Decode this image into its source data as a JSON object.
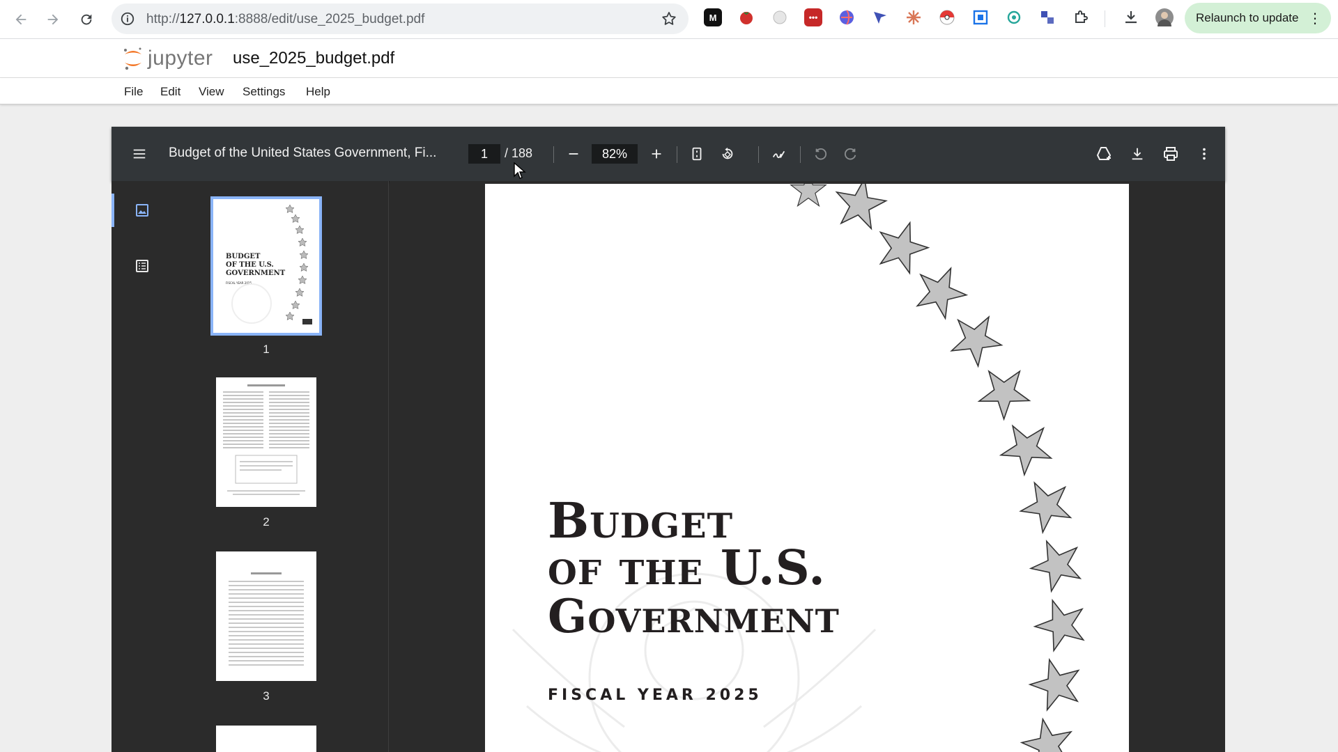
{
  "browser": {
    "url_prefix": "http://",
    "url_host": "127.0.0.1",
    "url_rest": ":8888/edit/use_2025_budget.pdf",
    "relaunch_label": "Relaunch to update",
    "extensions": [
      "M"
    ]
  },
  "jupyter": {
    "logo_text": "jupyter",
    "document_title": "use_2025_budget.pdf",
    "menu": [
      "File",
      "Edit",
      "View",
      "Settings",
      "Help"
    ]
  },
  "viewer": {
    "pdf_title": "Budget of the United States Government, Fi...",
    "current_page": "1",
    "total_pages": "/ 188",
    "zoom": "82%",
    "thumbnails": [
      "1",
      "2",
      "3"
    ]
  },
  "cover": {
    "line1": "Budget",
    "line2": "of the U.S.",
    "line3": "Government",
    "subtitle": "FISCAL YEAR 2025"
  },
  "colors": {
    "toolbar": "#323639",
    "viewer_bg": "#2b2b2b",
    "selection": "#8ab4f8",
    "relaunch_bg": "#d3f0d6"
  }
}
